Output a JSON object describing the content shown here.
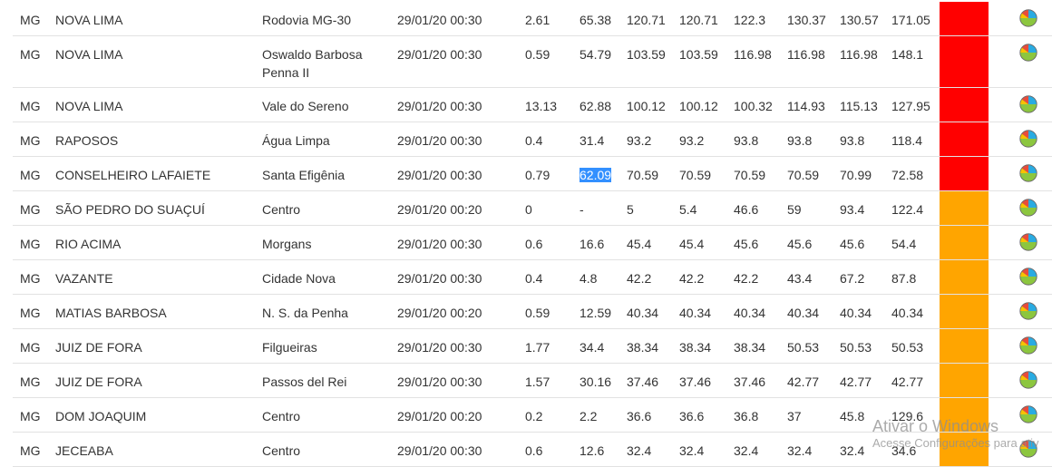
{
  "colors": {
    "red": "#ff0000",
    "orange": "#ffa500",
    "selection": "#3390ff",
    "pie_green": "#8cc63f",
    "pie_blue": "#29abe2",
    "pie_red": "#e74c3c",
    "pie_yellow": "#f7c200"
  },
  "rows": [
    {
      "uf": "MG",
      "city": "NOVA LIMA",
      "bairro": "Rodovia MG-30",
      "datetime": "29/01/20 00:30",
      "v": [
        "2.61",
        "65.38",
        "120.71",
        "120.71",
        "122.3",
        "130.37",
        "130.57",
        "171.05"
      ],
      "status": "red",
      "icon": "pie-chart-icon"
    },
    {
      "uf": "MG",
      "city": "NOVA LIMA",
      "bairro": "Oswaldo Barbosa Penna II",
      "datetime": "29/01/20 00:30",
      "v": [
        "0.59",
        "54.79",
        "103.59",
        "103.59",
        "116.98",
        "116.98",
        "116.98",
        "148.1"
      ],
      "status": "red",
      "icon": "pie-chart-icon"
    },
    {
      "uf": "MG",
      "city": "NOVA LIMA",
      "bairro": "Vale do Sereno",
      "datetime": "29/01/20 00:30",
      "v": [
        "13.13",
        "62.88",
        "100.12",
        "100.12",
        "100.32",
        "114.93",
        "115.13",
        "127.95"
      ],
      "status": "red",
      "icon": "pie-chart-icon"
    },
    {
      "uf": "MG",
      "city": "RAPOSOS",
      "bairro": "Água Limpa",
      "datetime": "29/01/20 00:30",
      "v": [
        "0.4",
        "31.4",
        "93.2",
        "93.2",
        "93.8",
        "93.8",
        "93.8",
        "118.4"
      ],
      "status": "red",
      "icon": "pie-chart-icon"
    },
    {
      "uf": "MG",
      "city": "CONSELHEIRO LAFAIETE",
      "bairro": "Santa Efigênia",
      "datetime": "29/01/20 00:30",
      "v": [
        "0.79",
        "62.09",
        "70.59",
        "70.59",
        "70.59",
        "70.59",
        "70.99",
        "72.58"
      ],
      "status": "red",
      "icon": "pie-chart-icon",
      "selected_col": 1
    },
    {
      "uf": "MG",
      "city": "SÃO PEDRO DO SUAÇUÍ",
      "bairro": "Centro",
      "datetime": "29/01/20 00:20",
      "v": [
        "0",
        "-",
        "5",
        "5.4",
        "46.6",
        "59",
        "93.4",
        "122.4"
      ],
      "status": "orange",
      "icon": "pie-chart-icon"
    },
    {
      "uf": "MG",
      "city": "RIO ACIMA",
      "bairro": "Morgans",
      "datetime": "29/01/20 00:30",
      "v": [
        "0.6",
        "16.6",
        "45.4",
        "45.4",
        "45.6",
        "45.6",
        "45.6",
        "54.4"
      ],
      "status": "orange",
      "icon": "pie-chart-icon"
    },
    {
      "uf": "MG",
      "city": "VAZANTE",
      "bairro": "Cidade Nova",
      "datetime": "29/01/20 00:30",
      "v": [
        "0.4",
        "4.8",
        "42.2",
        "42.2",
        "42.2",
        "43.4",
        "67.2",
        "87.8"
      ],
      "status": "orange",
      "icon": "pie-chart-icon"
    },
    {
      "uf": "MG",
      "city": "MATIAS BARBOSA",
      "bairro": "N. S. da Penha",
      "datetime": "29/01/20 00:20",
      "v": [
        "0.59",
        "12.59",
        "40.34",
        "40.34",
        "40.34",
        "40.34",
        "40.34",
        "40.34"
      ],
      "status": "orange",
      "icon": "pie-chart-icon"
    },
    {
      "uf": "MG",
      "city": "JUIZ DE FORA",
      "bairro": "Filgueiras",
      "datetime": "29/01/20 00:30",
      "v": [
        "1.77",
        "34.4",
        "38.34",
        "38.34",
        "38.34",
        "50.53",
        "50.53",
        "50.53"
      ],
      "status": "orange",
      "icon": "pie-chart-icon"
    },
    {
      "uf": "MG",
      "city": "JUIZ DE FORA",
      "bairro": "Passos del Rei",
      "datetime": "29/01/20 00:30",
      "v": [
        "1.57",
        "30.16",
        "37.46",
        "37.46",
        "37.46",
        "42.77",
        "42.77",
        "42.77"
      ],
      "status": "orange",
      "icon": "pie-chart-icon"
    },
    {
      "uf": "MG",
      "city": "DOM JOAQUIM",
      "bairro": "Centro",
      "datetime": "29/01/20 00:20",
      "v": [
        "0.2",
        "2.2",
        "36.6",
        "36.6",
        "36.8",
        "37",
        "45.8",
        "129.6"
      ],
      "status": "orange",
      "icon": "pie-chart-icon"
    },
    {
      "uf": "MG",
      "city": "JECEABA",
      "bairro": "Centro",
      "datetime": "29/01/20 00:30",
      "v": [
        "0.6",
        "12.6",
        "32.4",
        "32.4",
        "32.4",
        "32.4",
        "32.4",
        "34.6"
      ],
      "status": "orange",
      "icon": "pie-chart-icon"
    }
  ],
  "watermark": {
    "line1": "Ativar o Windows",
    "line2": "Acesse Configurações para ativ"
  }
}
